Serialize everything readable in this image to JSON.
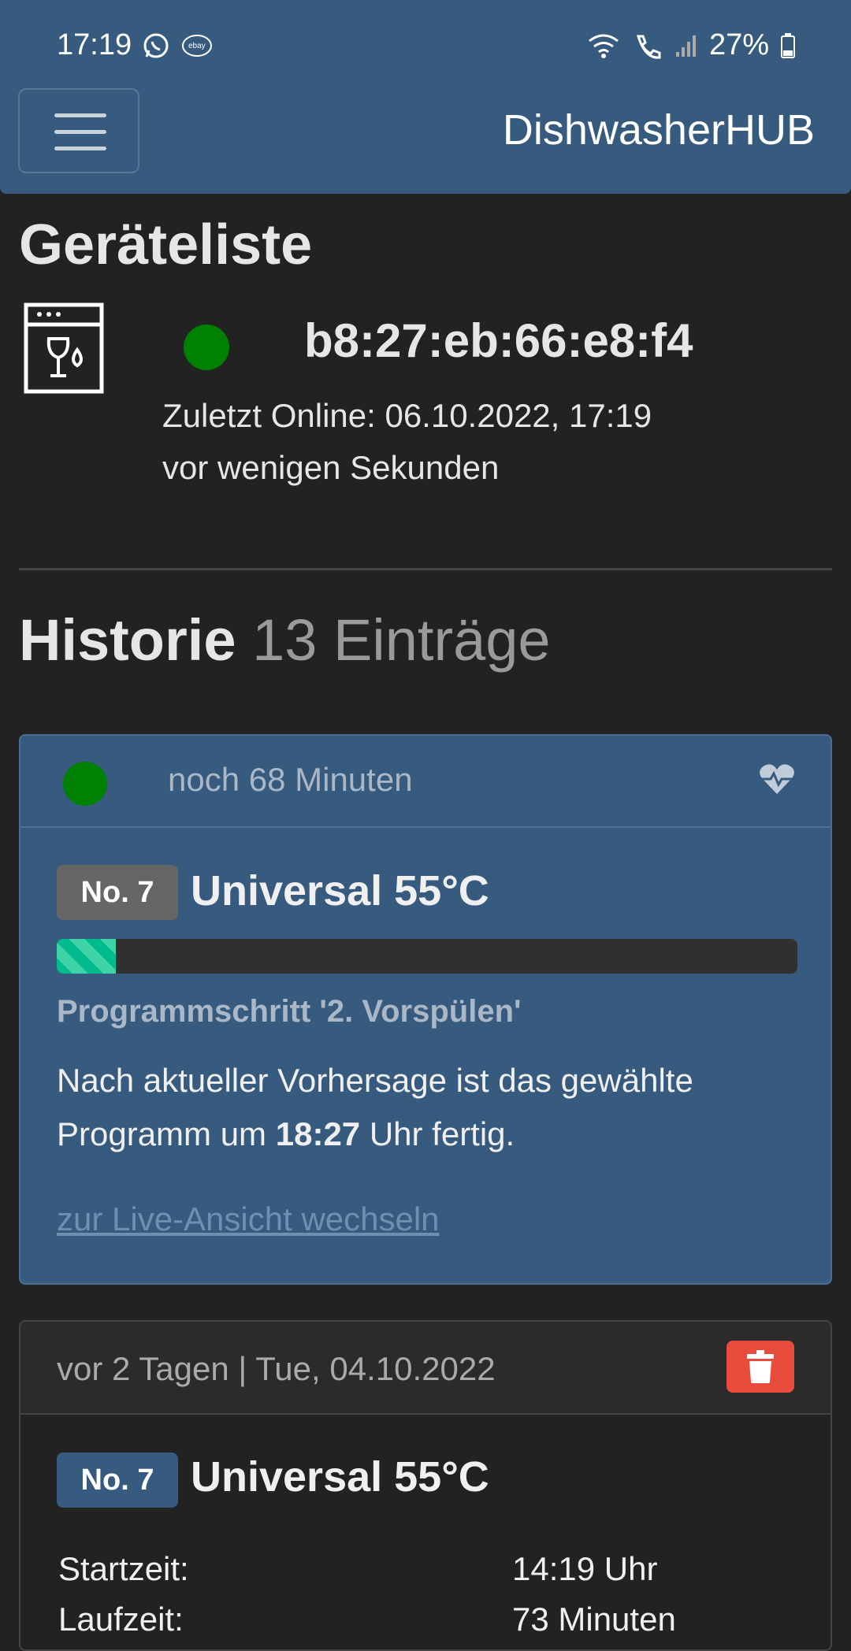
{
  "status_bar": {
    "time": "17:19",
    "battery": "27%",
    "icons": [
      "whatsapp-icon",
      "ebay-kleinanzeigen-icon",
      "wifi-icon",
      "wifi-call-icon",
      "signal-icon",
      "battery-icon"
    ]
  },
  "navbar": {
    "brand": "DishwasherHUB",
    "menu_icon": "hamburger-icon",
    "background": "#375a7f"
  },
  "devices": {
    "heading": "Geräteliste",
    "items": [
      {
        "icon": "dishwasher-icon",
        "status_color": "#008000",
        "mac": "b8:27:eb:66:e8:f4",
        "last_online": "Zuletzt Online: 06.10.2022, 17:19",
        "relative": "vor wenigen Sekunden"
      }
    ]
  },
  "history": {
    "heading": "Historie",
    "count": "13 Einträge",
    "active": {
      "status_color": "#008000",
      "remaining": "noch 68 Minuten",
      "icon": "heartbeat-icon",
      "badge": "No. 7",
      "program": "Universal 55°C",
      "progress": 0.08,
      "step": "Programmschritt '2. Vorspülen'",
      "forecast_prefix": "Nach aktueller Vorhersage ist das gewählte Programm um",
      "forecast_time": "18:27",
      "forecast_suffix": "Uhr fertig.",
      "link": "zur Live-Ansicht wechseln"
    },
    "entries": [
      {
        "date": "vor 2 Tagen | Tue, 04.10.2022",
        "delete_icon": "trash-icon",
        "badge": "No. 7",
        "program": "Universal 55°C",
        "rows": [
          {
            "label": "Startzeit:",
            "value": "14:19 Uhr"
          },
          {
            "label": "Laufzeit:",
            "value": "73 Minuten"
          }
        ]
      }
    ]
  }
}
